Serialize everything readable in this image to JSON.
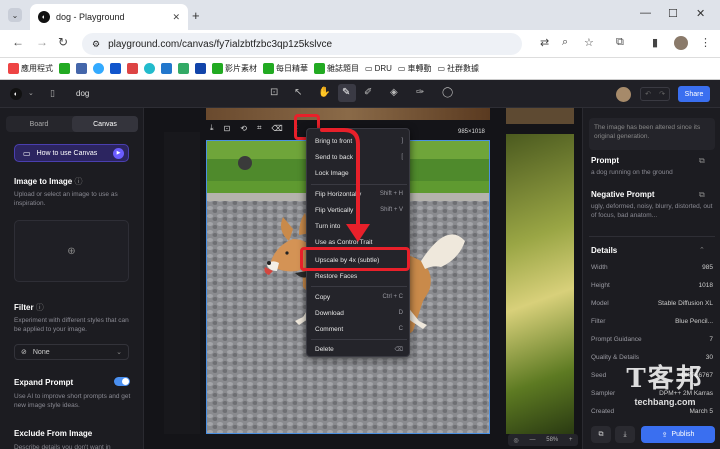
{
  "browser": {
    "tab_title": "dog - Playground",
    "url": "playground.com/canvas/fy7ialzbtfzbc3qp1z5kslvce",
    "bookmarks": [
      "應用程式",
      "影片素材",
      "每日精華",
      "雜誌題目",
      "DRU",
      "車轉動",
      "社群數據"
    ]
  },
  "app": {
    "doc_name": "dog",
    "share_label": "Share",
    "mode_tabs": [
      "Board",
      "Canvas"
    ],
    "active_mode": "Canvas"
  },
  "left": {
    "how_to": "How to use Canvas",
    "img2img_title": "Image to Image",
    "img2img_desc": "Upload or select an image to use as inspiration.",
    "filter_title": "Filter",
    "filter_desc": "Experiment with different styles that can be applied to your image.",
    "filter_value": "None",
    "expand_title": "Expand Prompt",
    "expand_desc": "Use AI to improve short prompts and get new image style ideas.",
    "exclude_title": "Exclude From Image",
    "exclude_desc": "Describe details you don't want in"
  },
  "canvas": {
    "dimensions": "985×1018",
    "zoom": "58%"
  },
  "menu": [
    {
      "label": "Bring to front",
      "key": "]"
    },
    {
      "label": "Send to back",
      "key": "["
    },
    {
      "label": "Lock Image",
      "key": ""
    },
    {
      "label": "Flip Horizontally",
      "key": "Shift + H"
    },
    {
      "label": "Flip Vertically",
      "key": "Shift + V"
    },
    {
      "label": "Turn into",
      "key": ""
    },
    {
      "label": "Use as Control Trait",
      "key": ""
    },
    {
      "label": "Upscale by 4x (subtle)",
      "key": ""
    },
    {
      "label": "Restore Faces",
      "key": ""
    },
    {
      "label": "Copy",
      "key": "Ctrl + C"
    },
    {
      "label": "Download",
      "key": "D"
    },
    {
      "label": "Comment",
      "key": "C"
    },
    {
      "label": "Delete",
      "key": "⌫"
    }
  ],
  "right": {
    "notice": "The image has been altered since its original generation.",
    "prompt_label": "Prompt",
    "prompt_text": "a dog running on the ground",
    "neg_label": "Negative Prompt",
    "neg_text": "ugly, deformed, noisy, blurry, distorted, out of focus, bad anatom...",
    "details_label": "Details",
    "details": [
      {
        "k": "Width",
        "v": "985"
      },
      {
        "k": "Height",
        "v": "1018"
      },
      {
        "k": "Model",
        "v": "Stable Diffusion XL"
      },
      {
        "k": "Filter",
        "v": "Blue Pencil..."
      },
      {
        "k": "Prompt Guidance",
        "v": "7"
      },
      {
        "k": "Quality & Details",
        "v": "30"
      },
      {
        "k": "Seed",
        "v": "167766767"
      },
      {
        "k": "Sampler",
        "v": "DPM++ 2M Karras"
      },
      {
        "k": "Created",
        "v": "March 5"
      }
    ],
    "publish_label": "Publish"
  },
  "watermark": {
    "line1": "T客邦",
    "line2": "techbang.com"
  },
  "colors": {
    "accent": "#3a6ff0",
    "annotation": "#e8202a",
    "selection": "#4a90e2"
  }
}
